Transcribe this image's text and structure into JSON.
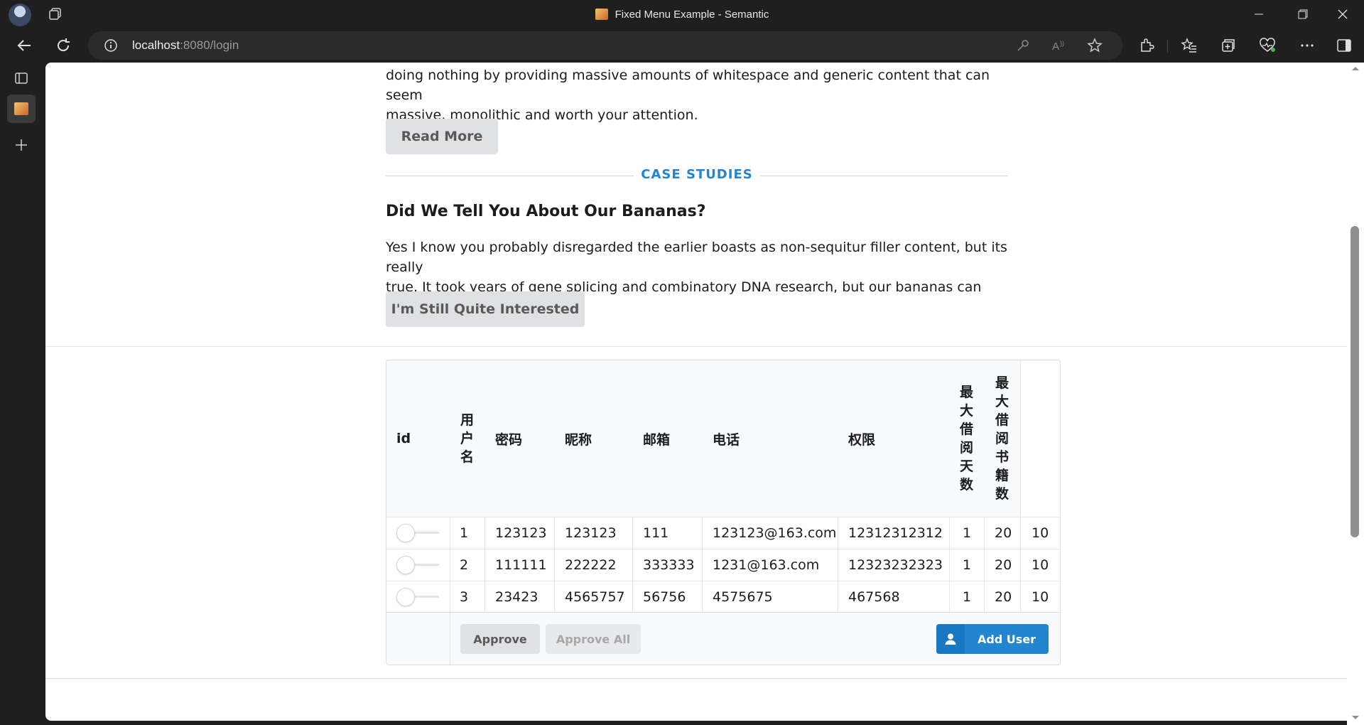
{
  "browser": {
    "window_title": "Fixed Menu Example - Semantic",
    "url_host": "localhost",
    "url_rest": ":8080/login"
  },
  "page": {
    "intro_line1": "doing nothing by providing massive amounts of whitespace and generic content that can seem",
    "intro_line2": "massive, monolithic and worth your attention.",
    "read_more": "Read More",
    "divider_label": "CASE STUDIES",
    "heading": "Did We Tell You About Our Bananas?",
    "para_line1": "Yes I know you probably disregarded the earlier boasts as non-sequitur filler content, but its really",
    "para_line2": "true. It took years of gene splicing and combinatory DNA research, but our bananas can really dance.",
    "interested_button": "I'm Still Quite Interested"
  },
  "table": {
    "headers": {
      "id": "id",
      "username": [
        "用",
        "户",
        "名"
      ],
      "password": "密码",
      "nickname": "昵称",
      "email": "邮箱",
      "phone": "电话",
      "permission": "权限",
      "max_days": [
        "最",
        "大",
        "借",
        "阅",
        "天",
        "数"
      ],
      "max_books": [
        "最",
        "大",
        "借",
        "阅",
        "书",
        "籍",
        "数"
      ]
    },
    "rows": [
      {
        "id": "1",
        "username": "123123",
        "password": "123123",
        "nickname": "111",
        "email": "123123@163.com",
        "phone": "12312312312",
        "permission": "1",
        "max_days": "20",
        "max_books": "10"
      },
      {
        "id": "2",
        "username": "111111",
        "password": "222222",
        "nickname": "333333",
        "email": "1231@163.com",
        "phone": "12323232323",
        "permission": "1",
        "max_days": "20",
        "max_books": "10"
      },
      {
        "id": "3",
        "username": "23423",
        "password": "4565757",
        "nickname": "56756",
        "email": "4575675",
        "phone": "467568",
        "permission": "1",
        "max_days": "20",
        "max_books": "10"
      }
    ],
    "approve": "Approve",
    "approve_all": "Approve All",
    "add_user": "Add User"
  },
  "icons": {
    "add_user_icon": "user-icon"
  },
  "colors": {
    "accent": "#2185d0",
    "button_grey": "#e0e1e2"
  }
}
